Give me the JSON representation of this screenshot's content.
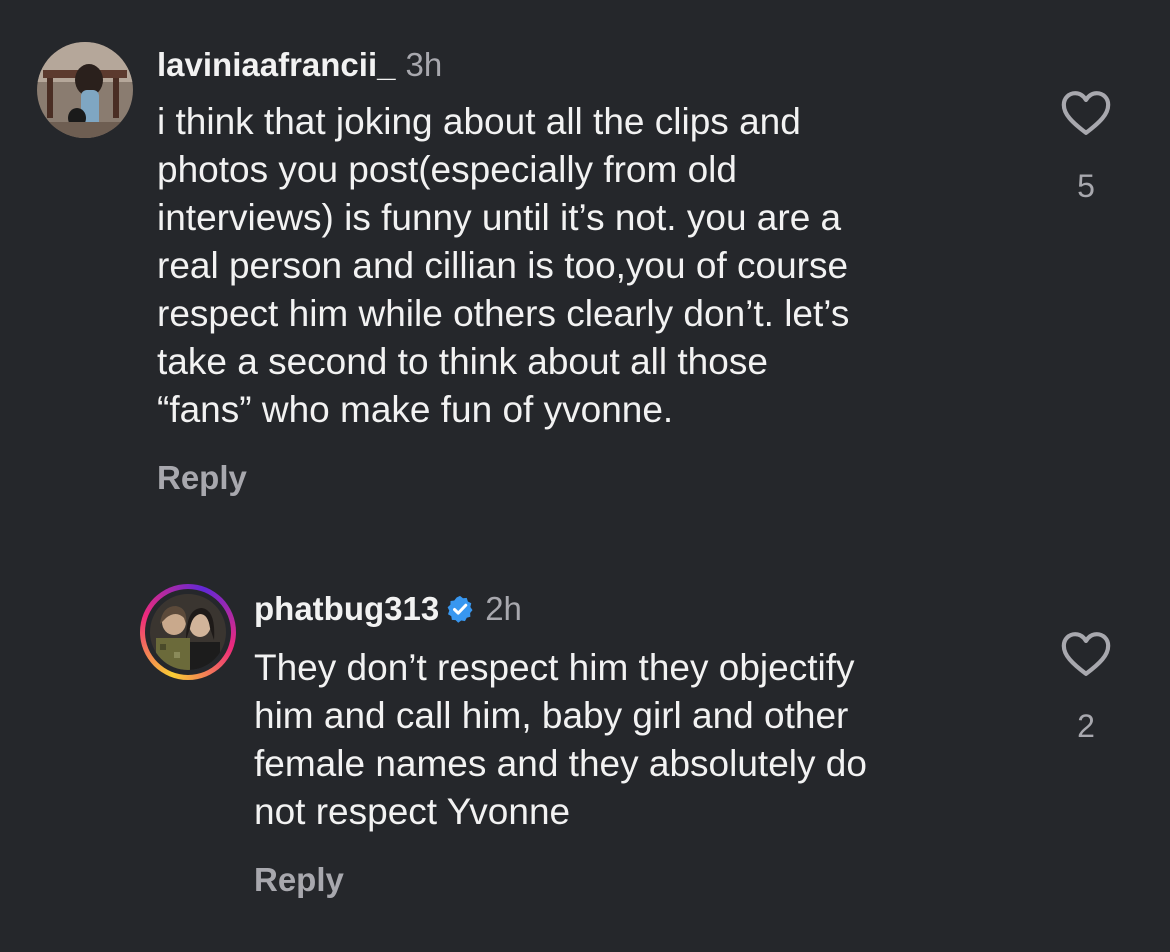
{
  "comments": [
    {
      "username": "laviniaafrancii_",
      "time": "3h",
      "verified": false,
      "body_lines": [
        "i think that joking about all the clips and",
        "photos you post(especially from old",
        "interviews) is funny until it’s not. you are a",
        "real person and cillian is too,you of course",
        "respect him while others clearly don’t. let’s",
        "take a second to think about all those",
        "“fans” who make fun of yvonne."
      ],
      "reply_label": "Reply",
      "like_count": "5",
      "like_icon": "heart-outline-icon"
    },
    {
      "username": "phatbug313",
      "time": "2h",
      "verified": true,
      "verified_icon": "verified-badge-icon",
      "body_lines": [
        "They don’t respect him they objectify",
        "him and call him, baby girl and other",
        "female names and they absolutely do",
        "not respect Yvonne"
      ],
      "reply_label": "Reply",
      "like_count": "2",
      "like_icon": "heart-outline-icon"
    }
  ],
  "colors": {
    "background": "#25272b",
    "text": "#f2f2f2",
    "muted": "#a8a8ae",
    "verified": "#3897f0",
    "story_ring_start": "#f9ce34",
    "story_ring_mid": "#ee2a7b",
    "story_ring_end": "#6228d7"
  }
}
